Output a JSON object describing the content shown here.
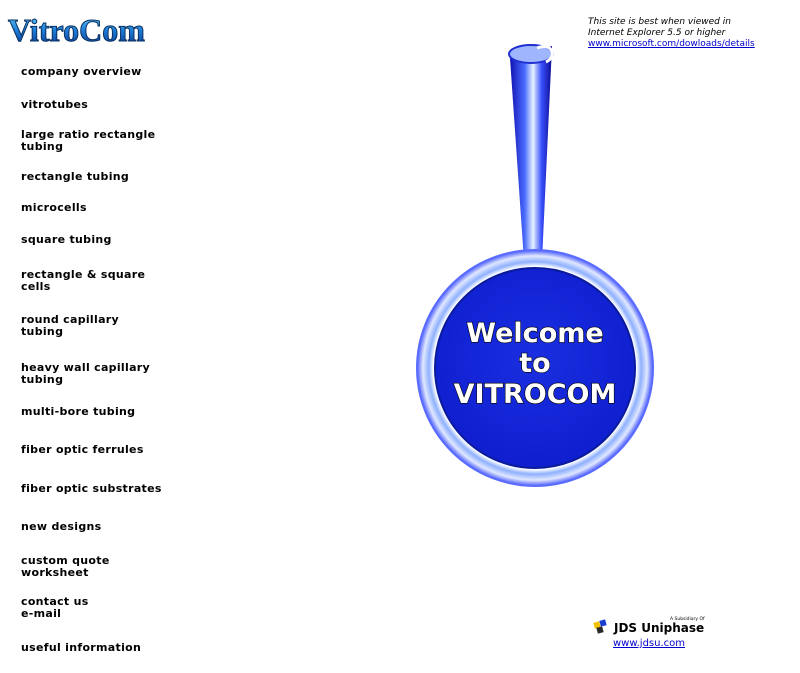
{
  "logo": {
    "text": "VitroCom"
  },
  "notice": {
    "line1": "This site is best when viewed in",
    "line2": "Internet Explorer 5.5 or higher",
    "link": "www.microsoft.com/dowloads/details"
  },
  "nav": [
    {
      "line1": "company overview"
    },
    {
      "line1": "vitrotubes"
    },
    {
      "line1": "large ratio rectangle",
      "line2": "tubing"
    },
    {
      "line1": "rectangle tubing"
    },
    {
      "line1": "microcells"
    },
    {
      "line1": "square tubing"
    },
    {
      "line1": "rectangle & square",
      "line2": "cells"
    },
    {
      "line1": "round capillary",
      "line2": "tubing"
    },
    {
      "line1": "heavy wall capillary",
      "line2": "tubing"
    },
    {
      "line1": "multi-bore tubing"
    },
    {
      "line1": "fiber optic ferrules"
    },
    {
      "line1": "fiber optic substrates"
    },
    {
      "line1": "new designs"
    },
    {
      "line1": "custom quote",
      "line2": "worksheet"
    },
    {
      "line1": "contact us",
      "line2": "e-mail"
    },
    {
      "line1": "useful information"
    }
  ],
  "welcome": {
    "line1": "Welcome",
    "line2": "to",
    "line3": "VITROCOM"
  },
  "jdsu": {
    "subsidiary": "A Subsidiary Of",
    "name": "JDS Uniphase",
    "link": "www.jdsu.com"
  },
  "colors": {
    "brand_blue": "#1a2fe0",
    "link_blue": "#0000cc"
  }
}
